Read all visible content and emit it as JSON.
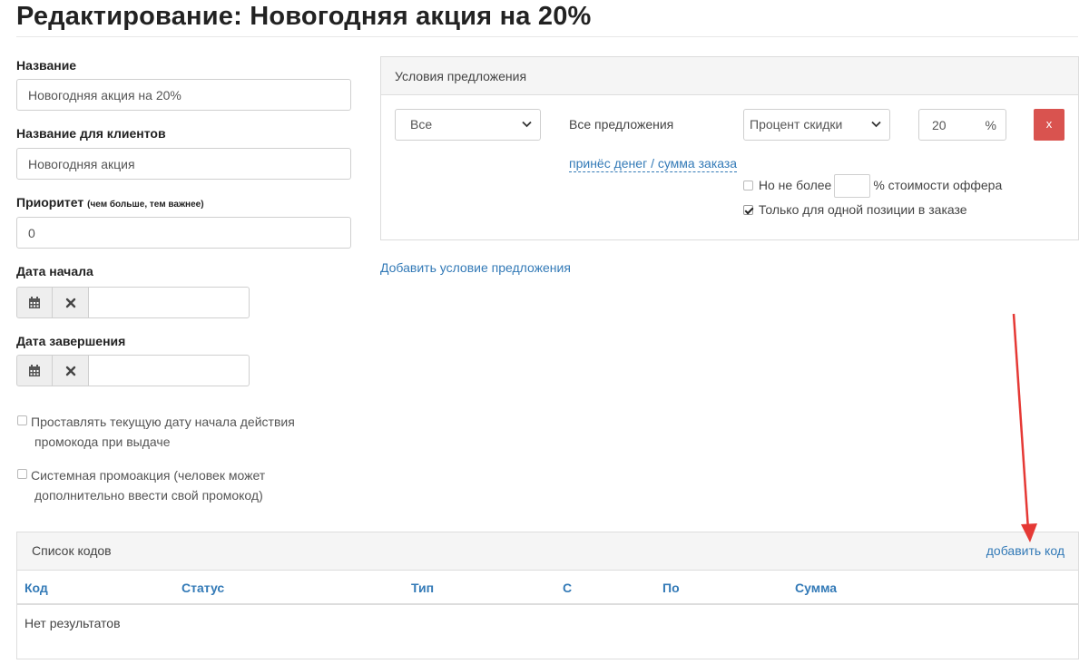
{
  "page": {
    "title": "Редактирование: Новогодняя акция на 20%"
  },
  "form": {
    "name_label": "Название",
    "name_value": "Новогодняя акция на 20%",
    "client_name_label": "Название для клиентов",
    "client_name_value": "Новогодняя акция",
    "priority_label": "Приоритет",
    "priority_hint": "(чем больше, тем важнее)",
    "priority_value": "0",
    "start_date_label": "Дата начала",
    "end_date_label": "Дата завершения",
    "checkbox_current_date_line1": "Проставлять текущую дату начала действия",
    "checkbox_current_date_line2": "промокода при выдаче",
    "checkbox_system_line1": "Системная промоакция (человек может",
    "checkbox_system_line2": "дополнительно ввести свой промокод)"
  },
  "conditions": {
    "header": "Условия предложения",
    "scope_select": "Все",
    "offers_text": "Все предложения",
    "discount_type_select": "Процент скидки",
    "percent_value": "20",
    "percent_unit": "%",
    "remove_label": "x",
    "brought_link": "принёс денег / сумма заказа",
    "max_prefix": "Но не более",
    "max_suffix": "% стоимости оффера",
    "single_position_label": "Только для одной позиции в заказе",
    "single_position_checked": true,
    "add_condition_link": "Добавить условие предложения"
  },
  "codes": {
    "header": "Список кодов",
    "add_link": "добавить код",
    "columns": [
      "Код",
      "Статус",
      "Тип",
      "С",
      "По",
      "Сумма"
    ],
    "empty_text": "Нет результатов"
  },
  "colors": {
    "link": "#337ab7",
    "danger": "#d9534f",
    "annotation_arrow": "#e53935"
  },
  "icons": {
    "calendar": "calendar-icon",
    "clear": "close-icon",
    "chevron": "chevron-down-icon"
  }
}
